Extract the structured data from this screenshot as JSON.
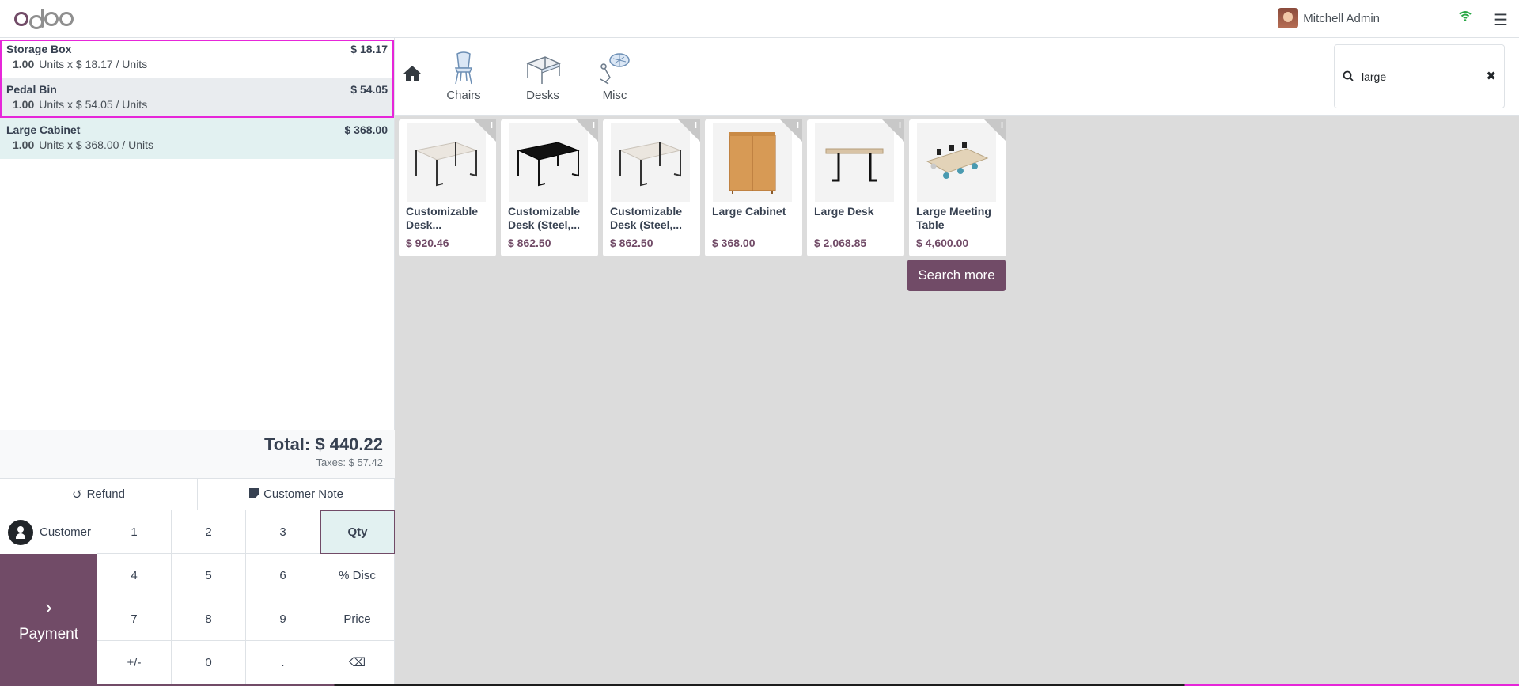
{
  "topbar": {
    "user_name": "Mitchell Admin"
  },
  "order": {
    "lines": [
      {
        "name": "Storage Box",
        "price": "$ 18.17",
        "qty": "1.00",
        "detail": "Units x $ 18.17 / Units"
      },
      {
        "name": "Pedal Bin",
        "price": "$ 54.05",
        "qty": "1.00",
        "detail": "Units x $ 54.05 / Units"
      },
      {
        "name": "Large Cabinet",
        "price": "$ 368.00",
        "qty": "1.00",
        "detail": "Units x $ 368.00 / Units"
      }
    ],
    "total": "Total: $ 440.22",
    "taxes": "Taxes: $ 57.42"
  },
  "controls": {
    "refund": "Refund",
    "customer_note": "Customer Note",
    "customer": "Customer",
    "payment": "Payment"
  },
  "numpad": {
    "keys": [
      "1",
      "2",
      "3",
      "Qty",
      "4",
      "5",
      "6",
      "% Disc",
      "7",
      "8",
      "9",
      "Price",
      "+/-",
      "0",
      ".",
      "⌫"
    ],
    "active": "Qty"
  },
  "categories": [
    {
      "label": "Chairs",
      "icon": "chair-icon"
    },
    {
      "label": "Desks",
      "icon": "desk-icon"
    },
    {
      "label": "Misc",
      "icon": "misc-icon"
    }
  ],
  "search": {
    "value": "large"
  },
  "products": [
    {
      "name": "Customizable Desk...",
      "price": "$ 920.46",
      "image": "white-desk-image"
    },
    {
      "name": "Customizable Desk (Steel,...",
      "price": "$ 862.50",
      "image": "black-desk-image"
    },
    {
      "name": "Customizable Desk (Steel,...",
      "price": "$ 862.50",
      "image": "white-desk-image"
    },
    {
      "name": "Large Cabinet",
      "price": "$ 368.00",
      "image": "cabinet-image"
    },
    {
      "name": "Large Desk",
      "price": "$ 2,068.85",
      "image": "standing-desk-image"
    },
    {
      "name": "Large Meeting Table",
      "price": "$ 4,600.00",
      "image": "meeting-table-image"
    }
  ],
  "search_more": "Search more",
  "colors": {
    "brand": "#714b67",
    "selection": "#e626d9",
    "selected_line": "#e2f1f1"
  }
}
